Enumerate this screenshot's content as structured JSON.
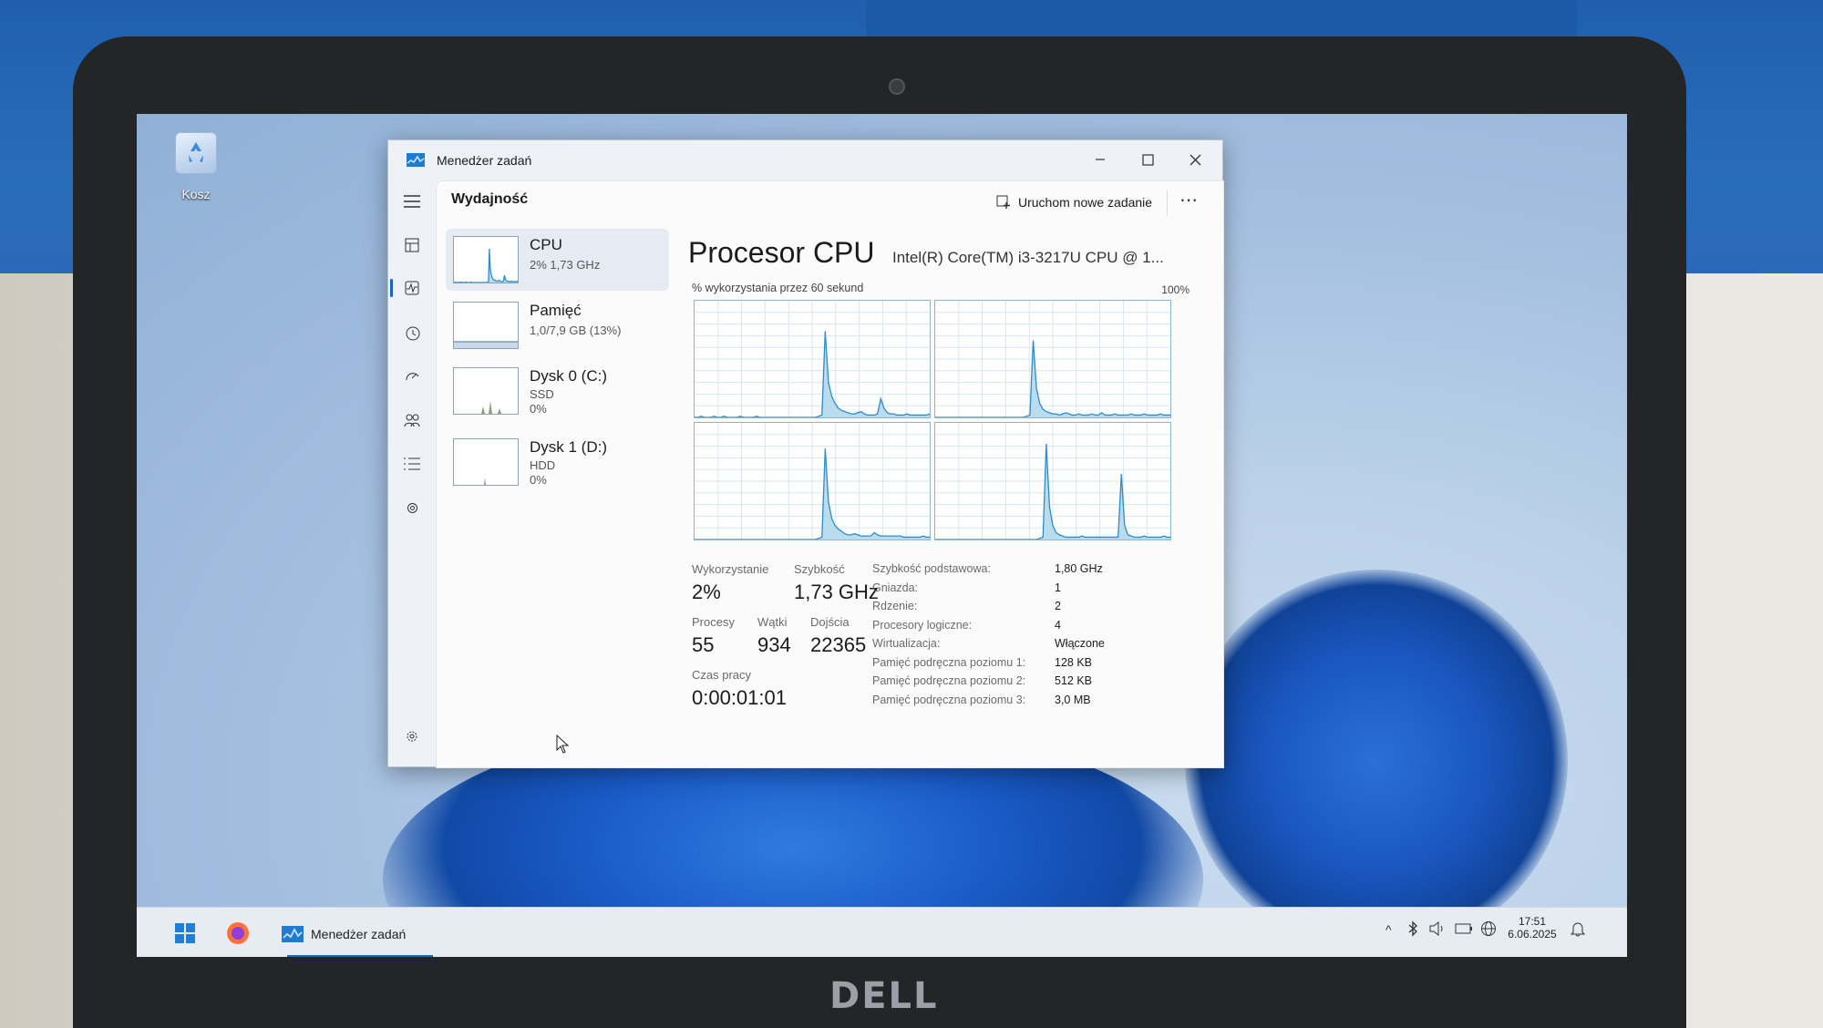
{
  "desktop": {
    "recycle_bin_label": "Kosz"
  },
  "window": {
    "title": "Menedżer zadań",
    "controls": [
      "minimize",
      "maximize",
      "close"
    ]
  },
  "header": {
    "page_title": "Wydajność",
    "run_new_task_label": "Uruchom nowe zadanie",
    "more_label": "⋯"
  },
  "nav_icons": [
    "hamburger-icon",
    "processes-icon",
    "performance-icon",
    "app-history-icon",
    "startup-apps-icon",
    "users-icon",
    "details-icon",
    "services-icon",
    "settings-icon"
  ],
  "sidebar": {
    "items": [
      {
        "title": "CPU",
        "sub1": "2% 1,73 GHz",
        "sub2": "",
        "sub3": "",
        "selected": true
      },
      {
        "title": "Pamięć",
        "sub1": "1,0/7,9 GB (13%)",
        "sub2": "",
        "sub3": "",
        "selected": false
      },
      {
        "title": "Dysk 0 (C:)",
        "sub1": "SSD",
        "sub2": "0%",
        "sub3": "",
        "selected": false
      },
      {
        "title": "Dysk 1 (D:)",
        "sub1": "HDD",
        "sub2": "0%",
        "sub3": "",
        "selected": false
      }
    ]
  },
  "cpu": {
    "heading": "Procesor CPU",
    "model": "Intel(R) Core(TM) i3-3217U CPU @ 1...",
    "graph_label": "% wykorzystania przez 60 sekund",
    "graph_max": "100%",
    "stats": {
      "utilization_label": "Wykorzystanie",
      "utilization_value": "2%",
      "speed_label": "Szybkość",
      "speed_value": "1,73 GHz",
      "processes_label": "Procesy",
      "processes_value": "55",
      "threads_label": "Wątki",
      "threads_value": "934",
      "handles_label": "Dojścia",
      "handles_value": "22365",
      "uptime_label": "Czas pracy",
      "uptime_value": "0:00:01:01"
    },
    "info": [
      {
        "key": "Szybkość podstawowa:",
        "value": "1,80 GHz"
      },
      {
        "key": "Gniazda:",
        "value": "1"
      },
      {
        "key": "Rdzenie:",
        "value": "2"
      },
      {
        "key": "Procesory logiczne:",
        "value": "4"
      },
      {
        "key": "Wirtualizacja:",
        "value": "Włączone"
      },
      {
        "key": "Pamięć podręczna poziomu 1:",
        "value": "128 KB"
      },
      {
        "key": "Pamięć podręczna poziomu 2:",
        "value": "512 KB"
      },
      {
        "key": "Pamięć podręczna poziomu 3:",
        "value": "3,0 MB"
      }
    ],
    "core_graphs": [
      [
        0,
        0,
        1,
        0,
        0,
        0,
        1,
        0,
        0,
        1,
        0,
        0,
        0,
        0,
        1,
        0,
        0,
        0,
        0,
        1,
        0,
        0,
        0,
        0,
        0,
        0,
        0,
        0,
        0,
        0,
        0,
        0,
        0,
        0,
        0,
        0,
        0,
        0,
        1,
        2,
        74,
        30,
        18,
        12,
        8,
        6,
        5,
        4,
        3,
        3,
        4,
        5,
        3,
        2,
        2,
        2,
        3,
        16,
        8,
        4,
        3,
        3,
        2,
        2,
        2,
        3,
        2,
        2,
        2,
        2,
        2,
        2,
        3
      ],
      [
        0,
        0,
        0,
        0,
        0,
        0,
        0,
        0,
        0,
        0,
        0,
        0,
        0,
        0,
        0,
        0,
        0,
        0,
        0,
        0,
        0,
        0,
        0,
        0,
        0,
        0,
        0,
        0,
        1,
        2,
        66,
        25,
        12,
        7,
        5,
        4,
        3,
        3,
        2,
        3,
        4,
        3,
        2,
        2,
        3,
        2,
        2,
        2,
        3,
        2,
        2,
        4,
        2,
        2,
        2,
        3,
        2,
        2,
        2,
        2,
        3,
        2,
        2,
        2,
        3,
        2,
        2,
        2,
        2,
        3,
        2,
        2,
        2
      ],
      [
        0,
        0,
        0,
        0,
        0,
        0,
        0,
        0,
        0,
        0,
        0,
        0,
        0,
        0,
        0,
        0,
        0,
        0,
        0,
        0,
        0,
        0,
        0,
        0,
        0,
        0,
        0,
        0,
        0,
        0,
        0,
        0,
        0,
        0,
        0,
        0,
        0,
        0,
        1,
        2,
        78,
        32,
        18,
        12,
        9,
        7,
        5,
        4,
        4,
        5,
        4,
        3,
        3,
        3,
        3,
        6,
        4,
        3,
        3,
        3,
        3,
        3,
        3,
        3,
        2,
        2,
        2,
        2,
        2,
        2,
        3,
        2,
        2
      ],
      [
        0,
        0,
        0,
        0,
        0,
        0,
        0,
        0,
        0,
        0,
        0,
        0,
        0,
        0,
        0,
        0,
        0,
        0,
        0,
        0,
        0,
        0,
        0,
        0,
        0,
        0,
        0,
        0,
        0,
        0,
        0,
        0,
        1,
        2,
        82,
        28,
        12,
        6,
        4,
        3,
        2,
        2,
        2,
        2,
        2,
        3,
        2,
        2,
        2,
        2,
        2,
        2,
        2,
        2,
        2,
        2,
        2,
        56,
        12,
        4,
        3,
        2,
        2,
        2,
        3,
        2,
        2,
        2,
        2,
        2,
        3,
        2,
        2
      ]
    ]
  },
  "taskbar": {
    "app_label": "Menedżer zadań",
    "time": "17:51",
    "date": "6.06.2025"
  },
  "laptop": {
    "brand": "DELL"
  }
}
